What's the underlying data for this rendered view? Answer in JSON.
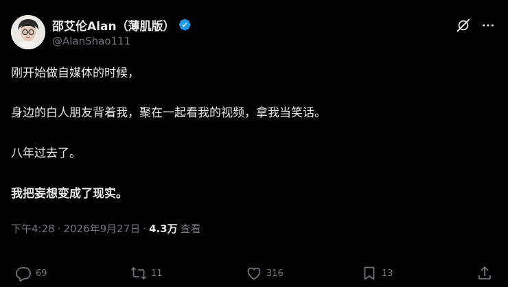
{
  "author": {
    "display_name": "邵艾伦Alan（薄肌版）",
    "handle": "@AlanShao111",
    "verified": true
  },
  "tweet": {
    "paragraphs": [
      "刚开始做自媒体的时候，",
      "身边的白人朋友背着我，聚在一起看我的视频，拿我当笑话。",
      "八年过去了。",
      "我把妄想变成了现实。"
    ],
    "time": "下午4:28",
    "date": "2026年9月27日",
    "separator": "·",
    "views_count": "4.3万",
    "views_label": "查看"
  },
  "actions": {
    "replies": "69",
    "retweets": "11",
    "likes": "316",
    "bookmarks": "13"
  },
  "icons": {
    "header": [
      "grok-icon",
      "more-icon"
    ],
    "actions": [
      "reply-icon",
      "retweet-icon",
      "like-icon",
      "bookmark-icon",
      "share-icon"
    ]
  },
  "colors": {
    "background": "#000000",
    "text_primary": "#e7e9ea",
    "text_secondary": "#71767b",
    "verified": "#1d9bf0"
  }
}
